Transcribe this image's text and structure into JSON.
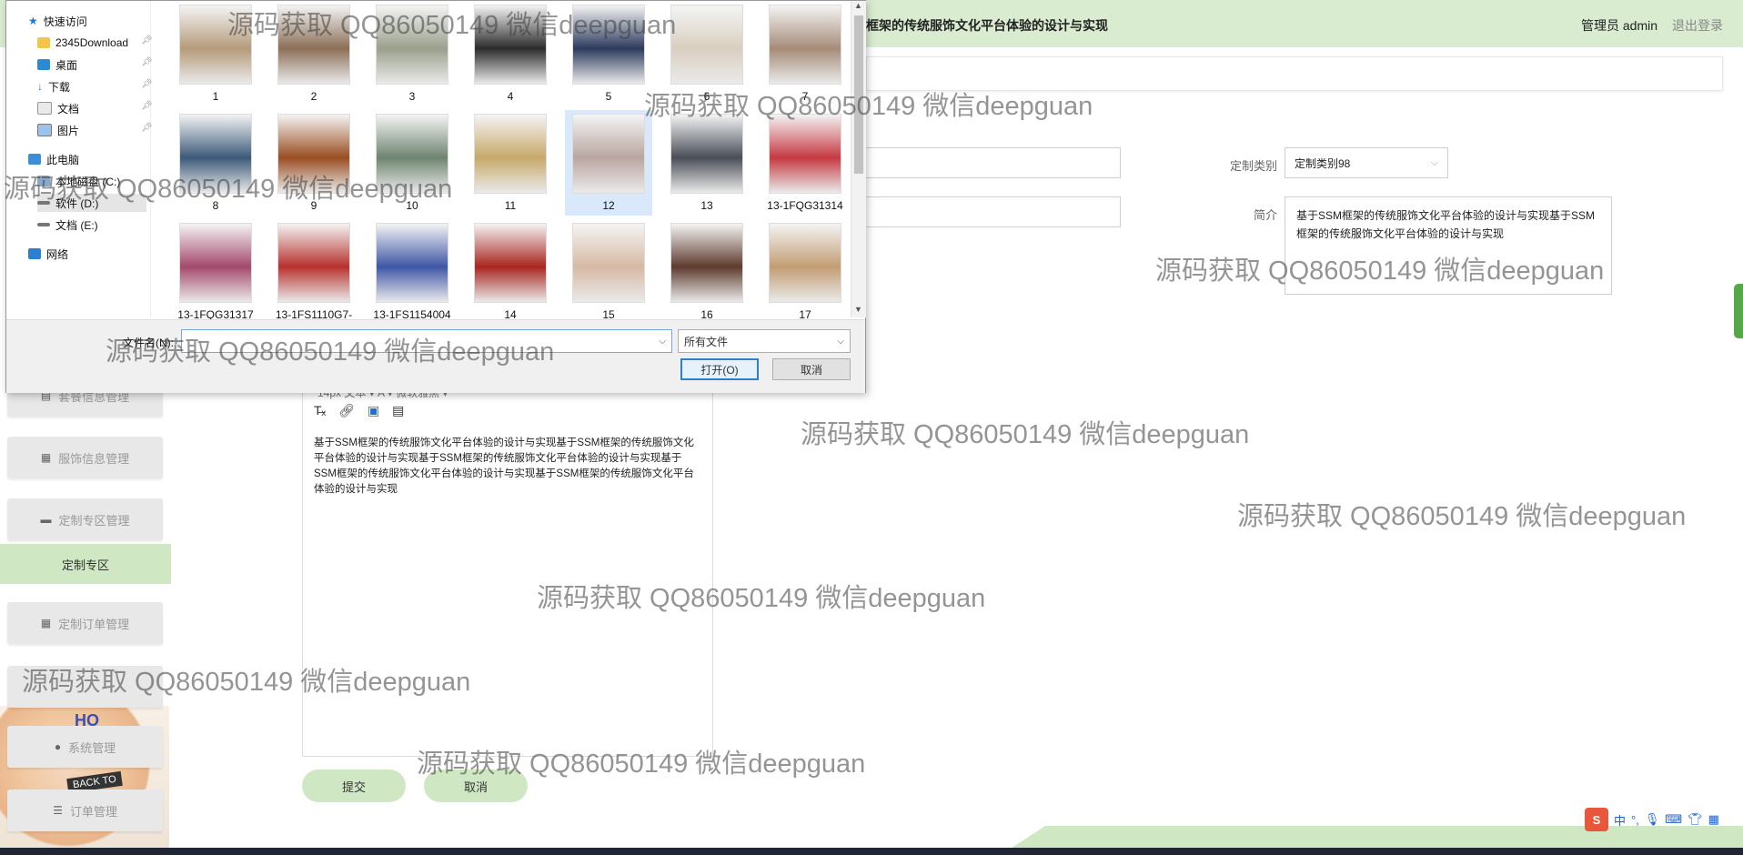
{
  "header": {
    "title": "框架的传统服饰文化平台体验的设计与实现",
    "user": "管理员 admin",
    "logout": "退出登录"
  },
  "form": {
    "category_label": "定制类别",
    "category_value": "定制类别98",
    "intro_label": "简介",
    "intro_text": "基于SSM框架的传统服饰文化平台体验的设计与实现基于SSM框架的传统服饰文化平台体验的设计与实现"
  },
  "sidebar": {
    "items": [
      {
        "label": "套餐信息管理",
        "icon": "doc-icon"
      },
      {
        "label": "服饰信息管理",
        "icon": "grid-icon"
      },
      {
        "label": "定制专区管理",
        "icon": "monitor-icon"
      },
      {
        "label": "定制专区",
        "icon": ""
      },
      {
        "label": "定制订单管理",
        "icon": "grid-icon"
      },
      {
        "label": "系统管理",
        "icon": "location-icon"
      },
      {
        "label": "订单管理",
        "icon": "list-icon"
      }
    ],
    "art_text_1": "HO",
    "art_text_2": "BACK TO"
  },
  "editor": {
    "toolbar_partial": "14px        文本         ▾    A  ▾    微软雅黑      ▾",
    "content": "基于SSM框架的传统服饰文化平台体验的设计与实现基于SSM框架的传统服饰文化平台体验的设计与实现基于SSM框架的传统服饰文化平台体验的设计与实现基于SSM框架的传统服饰文化平台体验的设计与实现基于SSM框架的传统服饰文化平台体验的设计与实现",
    "submit": "提交",
    "cancel": "取消"
  },
  "dialog": {
    "nav": [
      {
        "label": "快速访问",
        "icon": "star-icon",
        "pinned": false
      },
      {
        "label": "2345Download",
        "icon": "folder-icon",
        "pinned": true
      },
      {
        "label": "桌面",
        "icon": "desktop-icon",
        "pinned": true
      },
      {
        "label": "下载",
        "icon": "download-icon",
        "pinned": true
      },
      {
        "label": "文档",
        "icon": "document-icon",
        "pinned": true
      },
      {
        "label": "图片",
        "icon": "picture-icon",
        "pinned": true
      },
      {
        "label": "此电脑",
        "icon": "computer-icon",
        "pinned": false
      },
      {
        "label": "本地磁盘 (C:)",
        "icon": "drive-icon",
        "pinned": false
      },
      {
        "label": "软件 (D:)",
        "icon": "drive-icon",
        "pinned": false
      },
      {
        "label": "文档 (E:)",
        "icon": "drive-icon",
        "pinned": false
      },
      {
        "label": "网络",
        "icon": "network-icon",
        "pinned": false
      }
    ],
    "files": [
      {
        "name": "1",
        "color": "#b59b7a"
      },
      {
        "name": "2",
        "color": "#8c6f57"
      },
      {
        "name": "3",
        "color": "#9aa08c"
      },
      {
        "name": "4",
        "color": "#2b2b2b"
      },
      {
        "name": "5",
        "color": "#2d3b5e"
      },
      {
        "name": "6",
        "color": "#d9cfc0"
      },
      {
        "name": "7",
        "color": "#a68c78"
      },
      {
        "name": "8",
        "color": "#3d5a7a"
      },
      {
        "name": "9",
        "color": "#9a4e22"
      },
      {
        "name": "10",
        "color": "#6f8470"
      },
      {
        "name": "11",
        "color": "#c7a96a"
      },
      {
        "name": "12",
        "color": "#b9a6a0"
      },
      {
        "name": "13",
        "color": "#4a4e58"
      },
      {
        "name": "13-1FQG31314",
        "color": "#c63a42"
      },
      {
        "name": "13-1FQG31317",
        "color": "#a4496c"
      },
      {
        "name": "13-1FS1110G7-",
        "color": "#b7322e"
      },
      {
        "name": "13-1FS1154004",
        "color": "#3f56a6"
      },
      {
        "name": "14",
        "color": "#a8261f"
      },
      {
        "name": "15",
        "color": "#d7b9a4"
      },
      {
        "name": "16",
        "color": "#5e3b2e"
      },
      {
        "name": "17",
        "color": "#c39d73"
      }
    ],
    "filename_label": "文件名(N):",
    "filetype_value": "所有文件",
    "open": "打开(O)",
    "cancel": "取消"
  },
  "watermark": "源码获取 QQ86050149 微信deepguan",
  "ime": {
    "lang": "中"
  }
}
